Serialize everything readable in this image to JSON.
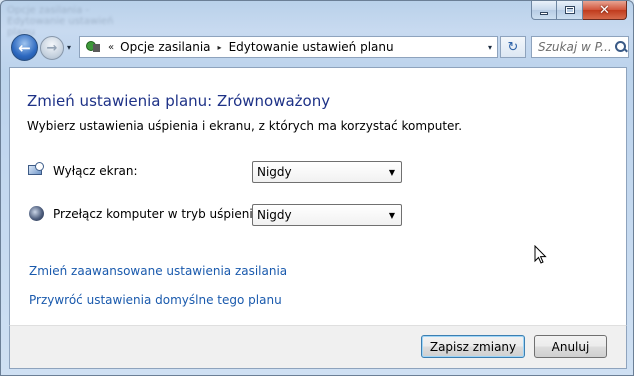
{
  "window": {
    "title_blurred": "Opcje zasilania - Edytowanie ustawień planu",
    "caption": {
      "minimize": "—",
      "maximize": "□",
      "close": "✕"
    }
  },
  "nav": {
    "back_glyph": "←",
    "forward_glyph": "→",
    "history_glyph": "▾",
    "breadcrumb": {
      "overflow": "«",
      "items": [
        "Opcje zasilania",
        "Edytowanie ustawień planu"
      ],
      "separator": "▸"
    },
    "address_drop_glyph": "▾",
    "refresh_glyph": "↻",
    "search_placeholder": "Szukaj w P..."
  },
  "main": {
    "title": "Zmień ustawienia planu: Zrównoważony",
    "subtitle": "Wybierz ustawienia uśpienia i ekranu, z których ma korzystać komputer.",
    "settings": [
      {
        "label": "Wyłącz ekran:",
        "value": "Nigdy",
        "icon": "monitor-clock-icon"
      },
      {
        "label": "Przełącz komputer w tryb uśpienia:",
        "value": "Nigdy",
        "icon": "moon-icon"
      }
    ],
    "links": {
      "advanced": "Zmień zaawansowane ustawienia zasilania",
      "restore": "Przywróć ustawienia domyślne tego planu"
    }
  },
  "footer": {
    "save": "Zapisz zmiany",
    "cancel": "Anuluj"
  },
  "colors": {
    "title": "#1e3287",
    "link": "#1a5aad",
    "frame": "#bcd3ec"
  }
}
